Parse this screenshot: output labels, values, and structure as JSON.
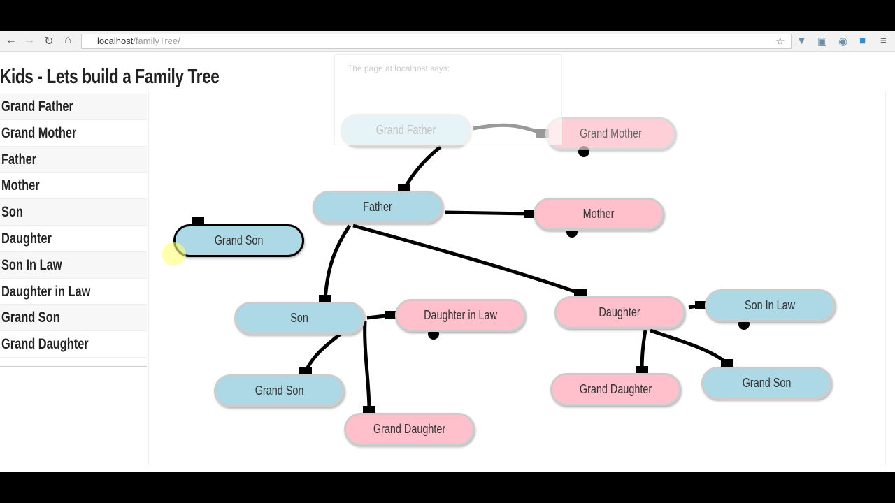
{
  "browser": {
    "url_host": "localhost",
    "url_path": "/familyTree/",
    "icons": [
      "back-icon",
      "forward-icon",
      "reload-icon",
      "home-icon",
      "star-icon",
      "download-icon",
      "extension-icon",
      "camera-icon",
      "extension-icon",
      "menu-icon"
    ]
  },
  "dialog": {
    "text": "The page at localhost says:"
  },
  "page": {
    "title": "Kids - Lets build a Family Tree"
  },
  "sidebar": {
    "items": [
      "Grand Father",
      "Grand Mother",
      "Father",
      "Mother",
      "Son",
      "Daughter",
      "Son In Law",
      "Daughter in Law",
      "Grand Son",
      "Grand Daughter"
    ]
  },
  "colors": {
    "male": "#add8e6",
    "female": "#ffc0cb",
    "edge": "#000000"
  },
  "tree": {
    "nodes": [
      {
        "id": "gf",
        "label": "Grand Father",
        "gender": "male"
      },
      {
        "id": "gm",
        "label": "Grand Mother",
        "gender": "female"
      },
      {
        "id": "f",
        "label": "Father",
        "gender": "male"
      },
      {
        "id": "m",
        "label": "Mother",
        "gender": "female"
      },
      {
        "id": "gs0",
        "label": "Grand Son",
        "gender": "male",
        "selected": true
      },
      {
        "id": "s",
        "label": "Son",
        "gender": "male"
      },
      {
        "id": "dil",
        "label": "Daughter in Law",
        "gender": "female"
      },
      {
        "id": "d",
        "label": "Daughter",
        "gender": "female"
      },
      {
        "id": "sil",
        "label": "Son In Law",
        "gender": "male"
      },
      {
        "id": "gs1",
        "label": "Grand Son",
        "gender": "male"
      },
      {
        "id": "gd1",
        "label": "Grand Daughter",
        "gender": "female"
      },
      {
        "id": "gd2",
        "label": "Grand Daughter",
        "gender": "female"
      },
      {
        "id": "gs2",
        "label": "Grand Son",
        "gender": "male"
      }
    ],
    "edges": [
      [
        "gf",
        "gm"
      ],
      [
        "gf",
        "f"
      ],
      [
        "f",
        "m"
      ],
      [
        "f",
        "s"
      ],
      [
        "f",
        "d"
      ],
      [
        "s",
        "dil"
      ],
      [
        "s",
        "gs1"
      ],
      [
        "s",
        "gd1"
      ],
      [
        "d",
        "sil"
      ],
      [
        "d",
        "gd2"
      ],
      [
        "d",
        "gs2"
      ]
    ]
  }
}
